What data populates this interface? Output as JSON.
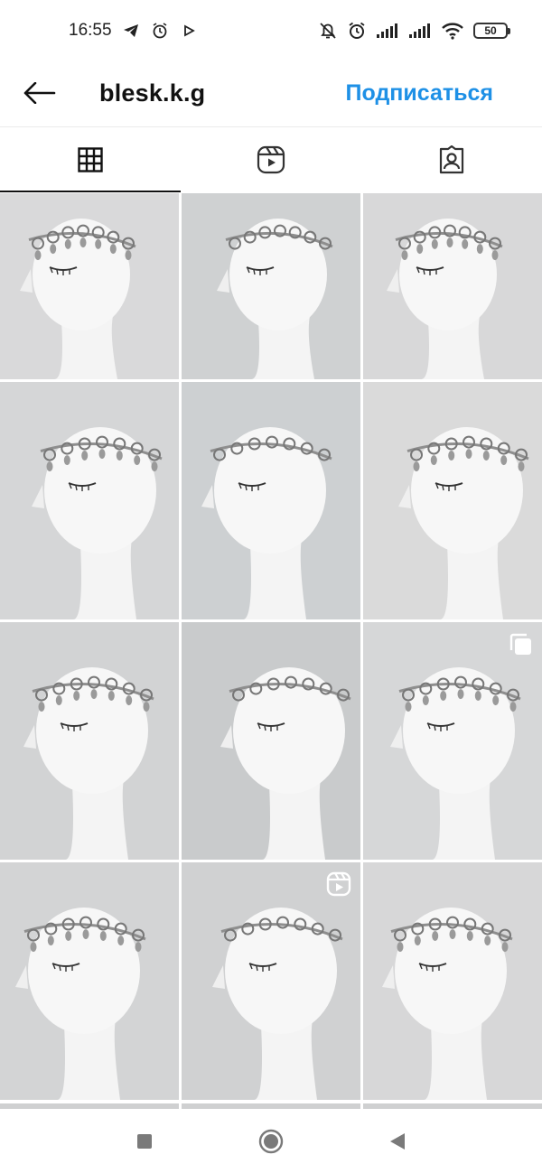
{
  "status_bar": {
    "time": "16:55",
    "battery": "50",
    "left_icons": [
      "telegram-icon",
      "alarm-icon",
      "play-icon"
    ],
    "right_icons": [
      "notifications-off-icon",
      "alarm-icon",
      "signal-icon",
      "signal-icon",
      "wifi-icon",
      "battery-icon"
    ]
  },
  "header": {
    "back_icon": "arrow-left-icon",
    "username": "blesk.k.g",
    "follow_label": "Подписаться",
    "follow_color": "#1e90e6"
  },
  "tabs": [
    {
      "name": "posts-grid",
      "icon": "grid-icon",
      "active": true
    },
    {
      "name": "reels",
      "icon": "reels-icon",
      "active": false
    },
    {
      "name": "tagged",
      "icon": "tagged-user-icon",
      "active": false
    }
  ],
  "posts": [
    {
      "type": "photo",
      "overlay": ""
    },
    {
      "type": "photo",
      "overlay": ""
    },
    {
      "type": "photo",
      "overlay": ""
    },
    {
      "type": "photo",
      "overlay": ""
    },
    {
      "type": "photo",
      "overlay": ""
    },
    {
      "type": "photo",
      "overlay": ""
    },
    {
      "type": "photo",
      "overlay": ""
    },
    {
      "type": "photo",
      "overlay": ""
    },
    {
      "type": "carousel",
      "overlay": "carousel-icon"
    },
    {
      "type": "photo",
      "overlay": ""
    },
    {
      "type": "reel",
      "overlay": "reels-icon"
    },
    {
      "type": "photo",
      "overlay": ""
    }
  ],
  "nav_bar": {
    "icons": [
      "recents-square-icon",
      "home-circle-icon",
      "back-triangle-icon"
    ]
  }
}
